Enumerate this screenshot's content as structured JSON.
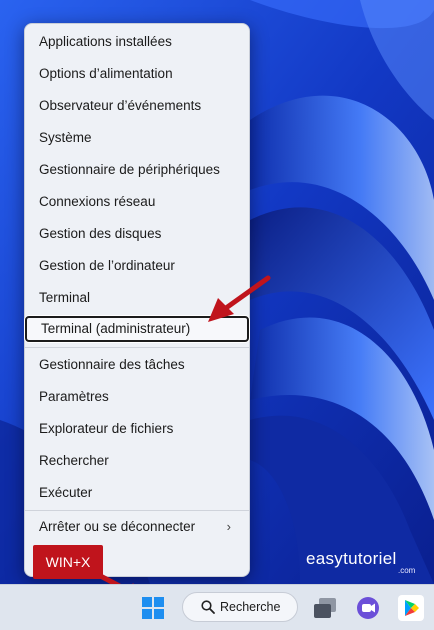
{
  "menu": {
    "items": [
      {
        "label": "Applications installées"
      },
      {
        "label": "Options d’alimentation"
      },
      {
        "label": "Observateur d’événements"
      },
      {
        "label": "Système"
      },
      {
        "label": "Gestionnaire de périphériques"
      },
      {
        "label": "Connexions réseau"
      },
      {
        "label": "Gestion des disques"
      },
      {
        "label": "Gestion de l’ordinateur"
      },
      {
        "label": "Terminal"
      },
      {
        "label": "Terminal (administrateur)",
        "highlighted": true
      },
      {
        "label": "Gestionnaire des tâches"
      },
      {
        "label": "Paramètres"
      },
      {
        "label": "Explorateur de fichiers"
      },
      {
        "label": "Rechercher"
      },
      {
        "label": "Exécuter"
      },
      {
        "label": "Arrêter ou se déconnecter",
        "submenu": true
      }
    ],
    "submenu_icon": "chevron-right-icon"
  },
  "annotation": {
    "shortcut_label": "WIN+X",
    "arrow_color": "#c0141c"
  },
  "watermark": {
    "brand": "easytutoriel",
    "domain": ".com"
  },
  "taskbar": {
    "search_label": "Recherche",
    "icons": [
      "windows-start-icon",
      "search-icon",
      "task-view-icon",
      "meet-icon",
      "play-store-icon"
    ]
  },
  "colors": {
    "accent": "#1a3fd0",
    "menu_bg": "#eef1f6",
    "highlight_border": "#1b1b1b"
  }
}
